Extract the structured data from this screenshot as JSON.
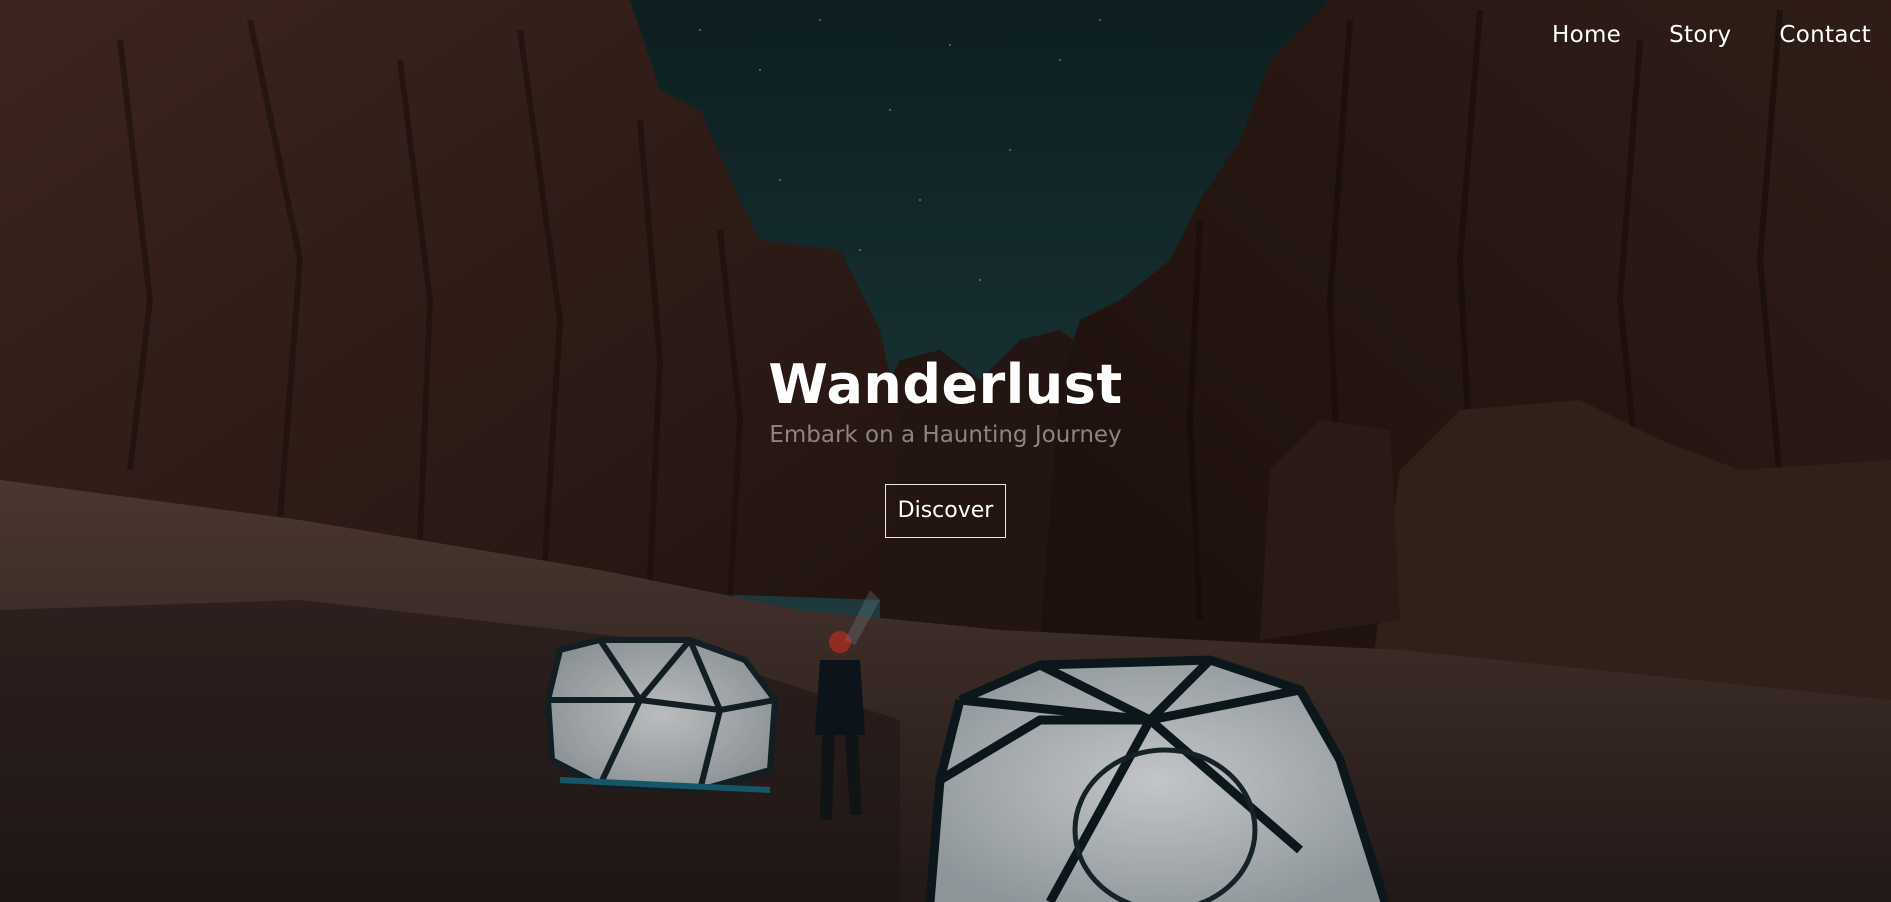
{
  "nav": {
    "items": [
      {
        "label": "Home"
      },
      {
        "label": "Story"
      },
      {
        "label": "Contact"
      }
    ]
  },
  "hero": {
    "title": "Wanderlust",
    "subtitle": "Embark on a Haunting Journey",
    "button_label": "Discover"
  },
  "colors": {
    "text": "#ffffff",
    "subtitle": "#8b8580",
    "sky": "#234a4d",
    "rock": "#3a221c",
    "sand": "#4a342f"
  }
}
